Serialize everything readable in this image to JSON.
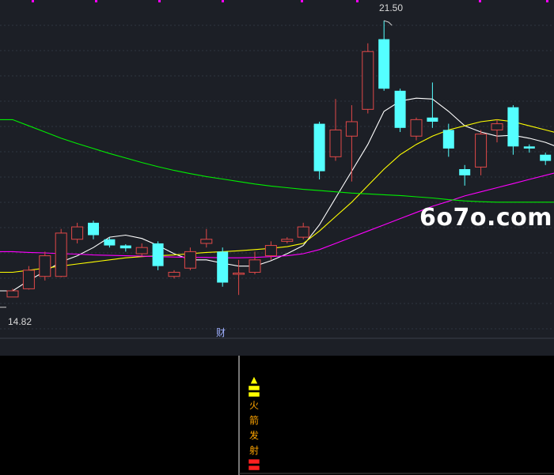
{
  "chart_data": {
    "type": "candlestick",
    "price_range": [
      13.8,
      22.0
    ],
    "high_label": "21.50",
    "low_label": "14.82",
    "event_label": "财",
    "colors": {
      "up": "#e04848",
      "down": "#54ffff",
      "ma_white": "#ffffff",
      "ma_yellow": "#ffff00",
      "ma_magenta": "#ff00ff",
      "ma_green": "#00ee00",
      "grid": "#2e3440",
      "background": "#1c1f26"
    },
    "candles": [
      {
        "open": 14.8,
        "close": 14.95,
        "high": 15.0,
        "low": 14.82
      },
      {
        "open": 15.0,
        "close": 15.45,
        "high": 15.55,
        "low": 14.98
      },
      {
        "open": 15.3,
        "close": 15.8,
        "high": 15.9,
        "low": 15.2
      },
      {
        "open": 15.3,
        "close": 16.35,
        "high": 16.45,
        "low": 15.28
      },
      {
        "open": 16.2,
        "close": 16.5,
        "high": 16.6,
        "low": 16.1
      },
      {
        "open": 16.6,
        "close": 16.3,
        "high": 16.65,
        "low": 16.2
      },
      {
        "open": 16.2,
        "close": 16.05,
        "high": 16.25,
        "low": 16.0
      },
      {
        "open": 16.05,
        "close": 15.98,
        "high": 16.08,
        "low": 15.9
      },
      {
        "open": 15.85,
        "close": 16.0,
        "high": 16.1,
        "low": 15.8
      },
      {
        "open": 16.1,
        "close": 15.55,
        "high": 16.15,
        "low": 15.45
      },
      {
        "open": 15.3,
        "close": 15.4,
        "high": 15.45,
        "low": 15.25
      },
      {
        "open": 15.5,
        "close": 15.9,
        "high": 16.0,
        "low": 15.45
      },
      {
        "open": 16.1,
        "close": 16.2,
        "high": 16.45,
        "low": 16.0
      },
      {
        "open": 15.9,
        "close": 15.15,
        "high": 16.0,
        "low": 15.05
      },
      {
        "open": 15.35,
        "close": 15.38,
        "high": 15.7,
        "low": 14.85
      },
      {
        "open": 15.4,
        "close": 15.7,
        "high": 15.9,
        "low": 15.35
      },
      {
        "open": 15.8,
        "close": 16.05,
        "high": 16.15,
        "low": 15.7
      },
      {
        "open": 16.15,
        "close": 16.2,
        "high": 16.25,
        "low": 16.1
      },
      {
        "open": 16.25,
        "close": 16.5,
        "high": 16.6,
        "low": 16.2
      },
      {
        "open": 19.0,
        "close": 17.85,
        "high": 19.05,
        "low": 17.65
      },
      {
        "open": 18.2,
        "close": 18.85,
        "high": 19.6,
        "low": 18.1
      },
      {
        "open": 18.7,
        "close": 19.05,
        "high": 19.45,
        "low": 17.6
      },
      {
        "open": 19.35,
        "close": 20.75,
        "high": 20.95,
        "low": 19.25
      },
      {
        "open": 21.05,
        "close": 19.85,
        "high": 21.5,
        "low": 19.8
      },
      {
        "open": 19.8,
        "close": 18.9,
        "high": 19.85,
        "low": 18.8
      },
      {
        "open": 18.7,
        "close": 19.1,
        "high": 19.15,
        "low": 18.6
      },
      {
        "open": 19.15,
        "close": 19.05,
        "high": 20.0,
        "low": 18.9
      },
      {
        "open": 18.85,
        "close": 18.4,
        "high": 19.0,
        "low": 18.2
      },
      {
        "open": 17.9,
        "close": 17.75,
        "high": 18.0,
        "low": 17.5
      },
      {
        "open": 17.95,
        "close": 18.75,
        "high": 18.85,
        "low": 17.75
      },
      {
        "open": 18.85,
        "close": 19.0,
        "high": 19.1,
        "low": 18.55
      },
      {
        "open": 19.4,
        "close": 18.45,
        "high": 19.45,
        "low": 18.25
      },
      {
        "open": 18.45,
        "close": 18.4,
        "high": 18.5,
        "low": 18.3
      },
      {
        "open": 18.25,
        "close": 18.1,
        "high": 18.3,
        "low": 18.0
      },
      {
        "open": 18.0,
        "close": 18.0,
        "high": 18.3,
        "low": 17.6
      }
    ],
    "ma_lines": [
      {
        "color": "#ffffff",
        "values": [
          14.95,
          15.2,
          15.42,
          15.65,
          15.8,
          16.0,
          16.25,
          16.3,
          16.22,
          16.05,
          15.85,
          15.7,
          15.7,
          15.62,
          15.55,
          15.55,
          15.68,
          15.85,
          16.05,
          16.55,
          17.2,
          17.85,
          18.5,
          19.3,
          19.55,
          19.62,
          19.6,
          19.3,
          18.95,
          18.8,
          18.7,
          18.72,
          18.65,
          18.55,
          18.4
        ]
      },
      {
        "color": "#ffff00",
        "values": [
          15.4,
          15.45,
          15.5,
          15.55,
          15.6,
          15.65,
          15.7,
          15.75,
          15.78,
          15.8,
          15.82,
          15.85,
          15.88,
          15.9,
          15.92,
          15.95,
          15.98,
          16.02,
          16.1,
          16.4,
          16.75,
          17.1,
          17.5,
          17.9,
          18.25,
          18.5,
          18.7,
          18.85,
          18.95,
          19.05,
          19.1,
          19.05,
          18.95,
          18.85,
          18.75
        ]
      },
      {
        "color": "#ff00ff",
        "values": [
          15.9,
          15.88,
          15.87,
          15.85,
          15.84,
          15.82,
          15.81,
          15.8,
          15.79,
          15.78,
          15.77,
          15.76,
          15.76,
          15.75,
          15.75,
          15.76,
          15.78,
          15.8,
          15.85,
          15.95,
          16.1,
          16.25,
          16.4,
          16.55,
          16.7,
          16.85,
          17.0,
          17.12,
          17.25,
          17.35,
          17.45,
          17.55,
          17.65,
          17.75,
          17.85
        ]
      },
      {
        "color": "#00ee00",
        "values": [
          19.1,
          18.95,
          18.8,
          18.65,
          18.52,
          18.4,
          18.28,
          18.17,
          18.06,
          17.96,
          17.87,
          17.79,
          17.72,
          17.66,
          17.6,
          17.54,
          17.49,
          17.45,
          17.41,
          17.38,
          17.35,
          17.32,
          17.3,
          17.28,
          17.26,
          17.23,
          17.2,
          17.16,
          17.13,
          17.11,
          17.1,
          17.1,
          17.1,
          17.1,
          17.1
        ]
      }
    ],
    "signal": {
      "marker_top": "▲",
      "marker_eq": "〓",
      "text_chars": [
        "火",
        "箭",
        "发",
        "射"
      ],
      "marker_bottom": "〓"
    }
  },
  "watermark": "6o7o.com"
}
